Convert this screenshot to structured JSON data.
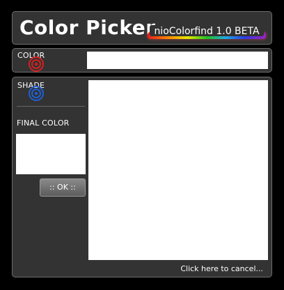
{
  "header": {
    "title": "Color Picker",
    "version": "nioColorfind 1.0 BETA"
  },
  "color_row": {
    "label": "COLOR",
    "value": "",
    "icon": "red-target-icon"
  },
  "shade_panel": {
    "label": "SHADE",
    "icon": "blue-target-icon",
    "final_color_label": "FINAL COLOR",
    "ok_label": ":: OK ::",
    "cancel_label": "Click here to cancel..."
  },
  "colors": {
    "background": "#000000",
    "panel": "#333333",
    "panel_border": "#6e6e6e",
    "color_icon": "#d42020",
    "shade_icon": "#1e5fd4"
  }
}
